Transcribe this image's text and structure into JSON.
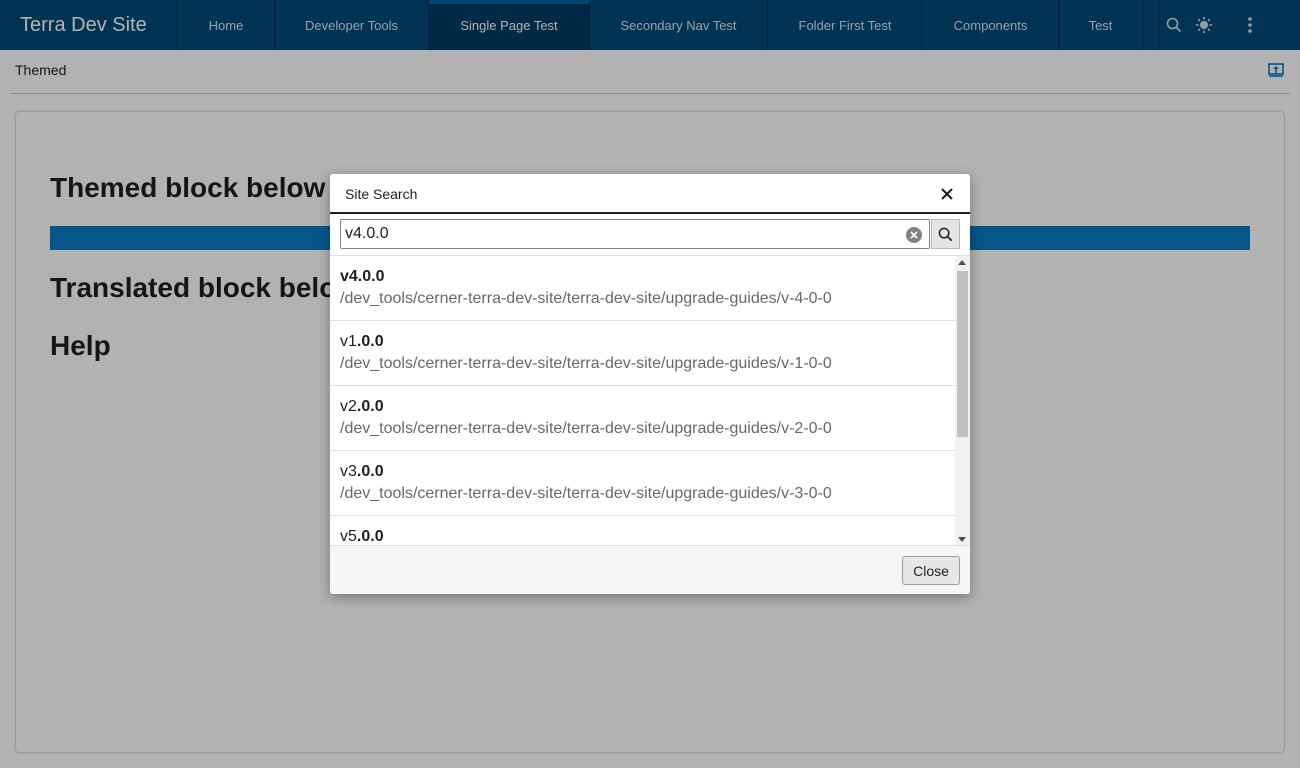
{
  "header": {
    "app_title": "Terra Dev Site",
    "nav": [
      {
        "label": "Home",
        "active": false
      },
      {
        "label": "Developer Tools",
        "active": false
      },
      {
        "label": "Single Page Test",
        "active": true
      },
      {
        "label": "Secondary Nav Test",
        "active": false
      },
      {
        "label": "Folder First Test",
        "active": false
      },
      {
        "label": "Components",
        "active": false
      },
      {
        "label": "Test",
        "active": false
      }
    ],
    "icons": [
      "search-icon",
      "theme-icon",
      "more-vertical-icon"
    ]
  },
  "page": {
    "subbar_title": "Themed",
    "subbar_icon": "menu-toggle-icon",
    "headings": {
      "themed": "Themed block below",
      "translated": "Translated block below",
      "help": "Help"
    }
  },
  "dialog": {
    "title": "Site Search",
    "search_value": "v4.0.0",
    "close_label": "Close",
    "results": [
      {
        "prefix": "v4",
        "bold": ".0.0",
        "full_bold": true,
        "path": "/dev_tools/cerner-terra-dev-site/terra-dev-site/upgrade-guides/v-4-0-0"
      },
      {
        "prefix": "v1",
        "bold": ".0.0",
        "full_bold": false,
        "path": "/dev_tools/cerner-terra-dev-site/terra-dev-site/upgrade-guides/v-1-0-0"
      },
      {
        "prefix": "v2",
        "bold": ".0.0",
        "full_bold": false,
        "path": "/dev_tools/cerner-terra-dev-site/terra-dev-site/upgrade-guides/v-2-0-0"
      },
      {
        "prefix": "v3",
        "bold": ".0.0",
        "full_bold": false,
        "path": "/dev_tools/cerner-terra-dev-site/terra-dev-site/upgrade-guides/v-3-0-0"
      },
      {
        "prefix": "v5",
        "bold": ".0.0",
        "full_bold": false,
        "path": ""
      }
    ]
  },
  "colors": {
    "header_bg": "#014979",
    "accent": "#0b7bc4"
  }
}
